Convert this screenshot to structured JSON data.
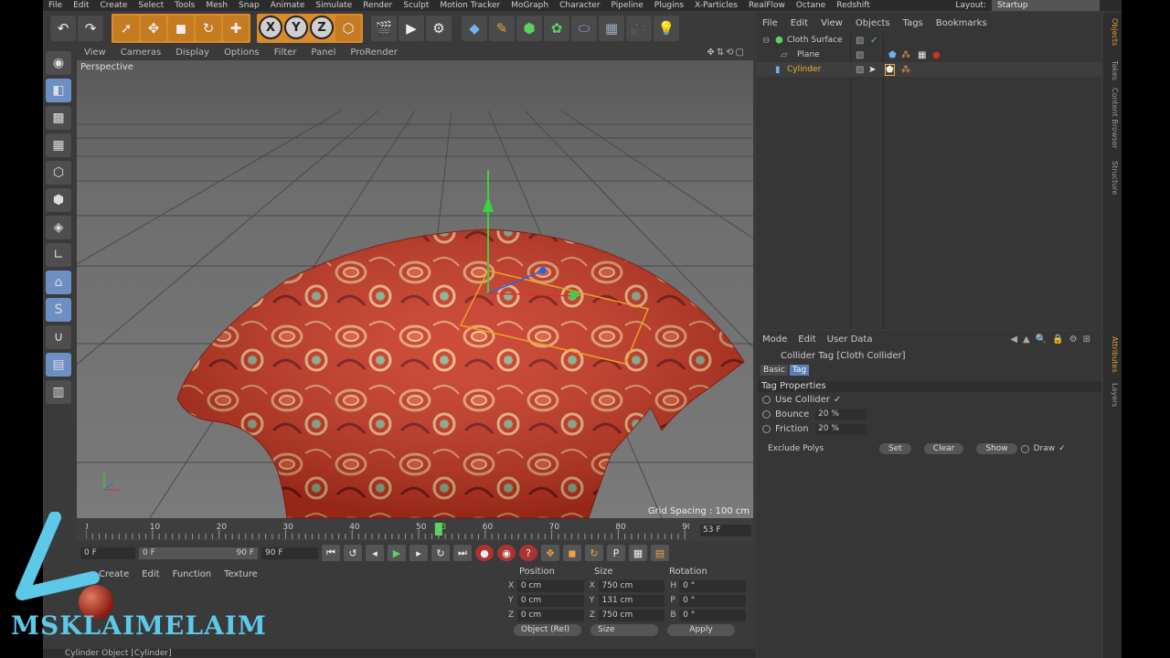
{
  "menubar": [
    "File",
    "Edit",
    "Create",
    "Select",
    "Tools",
    "Mesh",
    "Snap",
    "Animate",
    "Simulate",
    "Render",
    "Sculpt",
    "Motion Tracker",
    "MoGraph",
    "Character",
    "Pipeline",
    "Plugins",
    "X-Particles",
    "RealFlow",
    "Octane",
    "Redshift"
  ],
  "layout": {
    "label": "Layout:",
    "value": "Startup"
  },
  "viewport": {
    "menu": [
      "View",
      "Cameras",
      "Display",
      "Options",
      "Filter",
      "Panel",
      "ProRender"
    ],
    "camera_label": "Perspective",
    "grid_spacing": "Grid Spacing : 100 cm"
  },
  "timeline": {
    "ticks": [
      "0",
      "10",
      "20",
      "30",
      "40",
      "50",
      "53",
      "60",
      "70",
      "80",
      "90"
    ],
    "current": "53 F"
  },
  "transport": {
    "start": "0 F",
    "min": "0 F",
    "max": "90 F",
    "end": "90 F"
  },
  "material_manager": {
    "menu": [
      "Create",
      "Edit",
      "Function",
      "Texture"
    ]
  },
  "coords": {
    "headers": [
      "Position",
      "Size",
      "Rotation"
    ],
    "rows": [
      {
        "pa": "X",
        "pv": "0 cm",
        "sa": "X",
        "sv": "750 cm",
        "ra": "H",
        "rv": "0 °"
      },
      {
        "pa": "Y",
        "pv": "0 cm",
        "sa": "Y",
        "sv": "131 cm",
        "ra": "P",
        "rv": "0 °"
      },
      {
        "pa": "Z",
        "pv": "0 cm",
        "sa": "Z",
        "sv": "750 cm",
        "ra": "B",
        "rv": "0 °"
      }
    ],
    "mode": "Object (Rel)",
    "size_mode": "Size",
    "apply": "Apply"
  },
  "status": "Cylinder Object [Cylinder]",
  "object_manager": {
    "menu": [
      "File",
      "Edit",
      "View",
      "Objects",
      "Tags",
      "Bookmarks"
    ],
    "objects": [
      "Cloth Surface",
      "Plane",
      "Cylinder"
    ]
  },
  "attribute_manager": {
    "menu": [
      "Mode",
      "Edit",
      "User Data"
    ],
    "title": "Collider Tag [Cloth Collider]",
    "tabs": [
      "Basic",
      "Tag"
    ],
    "section": "Tag Properties",
    "use_collider": "Use Collider",
    "checkmark": "✓",
    "bounce": {
      "label": "Bounce",
      "value": "20 %"
    },
    "friction": {
      "label": "Friction",
      "value": "20 %"
    },
    "exclude_polys": "Exclude Polys",
    "buttons": [
      "Set",
      "Clear",
      "Show"
    ],
    "draw": "Draw"
  },
  "side_tabs": [
    "Objects",
    "Takes",
    "Content Browser",
    "Structure",
    "Attributes",
    "Layers"
  ],
  "watermark": "MSKLAIMELAIM",
  "colors": {
    "accent": "#d88a2c",
    "selection": "#f0b030",
    "tab_active": "#5b7fb5",
    "cloth": "#c8341f",
    "watermark": "#5ec8e8"
  }
}
